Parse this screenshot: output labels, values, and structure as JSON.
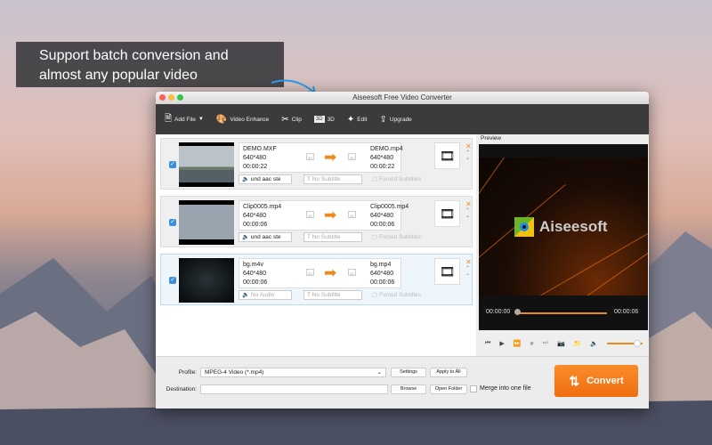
{
  "callout": {
    "line1": "Support batch conversion and",
    "line2": "almost any popular video"
  },
  "window": {
    "title": "Aiseesoft Free Video Converter"
  },
  "toolbar": {
    "add_file": "Add File",
    "video_enhance": "Video Enhance",
    "clip": "Clip",
    "three_d": "3D",
    "three_d_badge": "3D",
    "edit": "Edit",
    "upgrade": "Upgrade"
  },
  "files": [
    {
      "src_name": "DEMO.MXF",
      "src_res": "640*480",
      "src_dur": "00:00:22",
      "out_name": "DEMO.mp4",
      "out_res": "640*480",
      "out_dur": "00:00:22",
      "audio": "und aac ste",
      "subtitle": "No Subtitle",
      "forced": "Forced Subtitles",
      "badge": "2D",
      "checked": true
    },
    {
      "src_name": "Clip0005.mp4",
      "src_res": "640*480",
      "src_dur": "00:00:06",
      "out_name": "Clip0005.mp4",
      "out_res": "640*480",
      "out_dur": "00:00:06",
      "audio": "und aac ste",
      "subtitle": "No Subtitle",
      "forced": "Forced Subtitles",
      "badge": "2D",
      "checked": true
    },
    {
      "src_name": "bg.m4v",
      "src_res": "640*480",
      "src_dur": "00:00:06",
      "out_name": "bg.mp4",
      "out_res": "640*480",
      "out_dur": "00:00:06",
      "audio": "No Audio",
      "subtitle": "No Subtitle",
      "forced": "Forced Subtitles",
      "badge": "2D",
      "checked": true
    }
  ],
  "preview": {
    "header": "Preview",
    "logo_text": "Aiseesoft",
    "time_current": "00:00:00",
    "time_total": "00:00:06",
    "progress": 0,
    "volume": 0.85
  },
  "bottom": {
    "profile_label": "Profile:",
    "profile_value": "MPEG-4 Video (*.mp4)",
    "destination_label": "Destination:",
    "destination_value": "",
    "settings": "Settings",
    "apply_all": "Apply to All",
    "browse": "Browse",
    "open_folder": "Open Folder",
    "merge": "Merge into one file",
    "convert": "Convert"
  },
  "colors": {
    "accent": "#f08a1c",
    "toolbar": "#3b3b3e"
  }
}
